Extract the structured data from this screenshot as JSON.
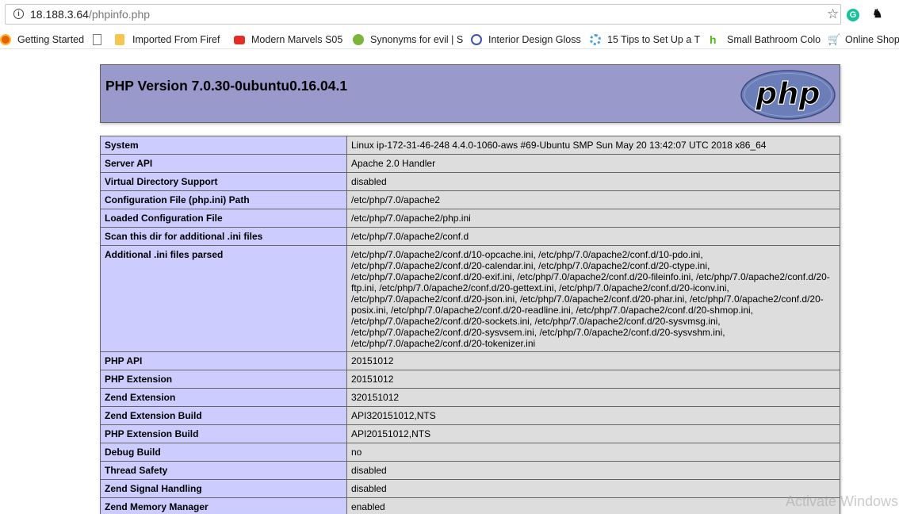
{
  "browser": {
    "url_host": "18.188.3.64",
    "url_path": "/phpinfo.php",
    "bookmarks": [
      {
        "label": "Getting Started",
        "icon": "firefox-icon"
      },
      {
        "label": "",
        "icon": "page-icon"
      },
      {
        "label": "Imported From Firef",
        "icon": "folder-icon"
      },
      {
        "label": "Modern Marvels S05",
        "icon": "youtube-icon"
      },
      {
        "label": "Synonyms for evil | S",
        "icon": "synonyms-icon"
      },
      {
        "label": "Interior Design Gloss",
        "icon": "q-icon"
      },
      {
        "label": "15 Tips to Set Up a T",
        "icon": "gear-icon"
      },
      {
        "label": "Small Bathroom Colo",
        "icon": "houzz-icon"
      },
      {
        "label": "Online Shop",
        "icon": "cart-icon"
      }
    ]
  },
  "phpinfo": {
    "title": "PHP Version 7.0.30-0ubuntu0.16.04.1",
    "logo_text": "php",
    "rows": [
      {
        "key": "System",
        "value": "Linux ip-172-31-46-248 4.4.0-1060-aws #69-Ubuntu SMP Sun May 20 13:42:07 UTC 2018 x86_64"
      },
      {
        "key": "Server API",
        "value": "Apache 2.0 Handler"
      },
      {
        "key": "Virtual Directory Support",
        "value": "disabled"
      },
      {
        "key": "Configuration File (php.ini) Path",
        "value": "/etc/php/7.0/apache2"
      },
      {
        "key": "Loaded Configuration File",
        "value": "/etc/php/7.0/apache2/php.ini"
      },
      {
        "key": "Scan this dir for additional .ini files",
        "value": "/etc/php/7.0/apache2/conf.d"
      },
      {
        "key": "Additional .ini files parsed",
        "value": "/etc/php/7.0/apache2/conf.d/10-opcache.ini, /etc/php/7.0/apache2/conf.d/10-pdo.ini, /etc/php/7.0/apache2/conf.d/20-calendar.ini, /etc/php/7.0/apache2/conf.d/20-ctype.ini, /etc/php/7.0/apache2/conf.d/20-exif.ini, /etc/php/7.0/apache2/conf.d/20-fileinfo.ini, /etc/php/7.0/apache2/conf.d/20-ftp.ini, /etc/php/7.0/apache2/conf.d/20-gettext.ini, /etc/php/7.0/apache2/conf.d/20-iconv.ini, /etc/php/7.0/apache2/conf.d/20-json.ini, /etc/php/7.0/apache2/conf.d/20-phar.ini, /etc/php/7.0/apache2/conf.d/20-posix.ini, /etc/php/7.0/apache2/conf.d/20-readline.ini, /etc/php/7.0/apache2/conf.d/20-shmop.ini, /etc/php/7.0/apache2/conf.d/20-sockets.ini, /etc/php/7.0/apache2/conf.d/20-sysvmsg.ini, /etc/php/7.0/apache2/conf.d/20-sysvsem.ini, /etc/php/7.0/apache2/conf.d/20-sysvshm.ini, /etc/php/7.0/apache2/conf.d/20-tokenizer.ini"
      },
      {
        "key": "PHP API",
        "value": "20151012"
      },
      {
        "key": "PHP Extension",
        "value": "20151012"
      },
      {
        "key": "Zend Extension",
        "value": "320151012"
      },
      {
        "key": "Zend Extension Build",
        "value": "API320151012,NTS"
      },
      {
        "key": "PHP Extension Build",
        "value": "API20151012,NTS"
      },
      {
        "key": "Debug Build",
        "value": "no"
      },
      {
        "key": "Thread Safety",
        "value": "disabled"
      },
      {
        "key": "Zend Signal Handling",
        "value": "disabled"
      },
      {
        "key": "Zend Memory Manager",
        "value": "enabled"
      }
    ]
  },
  "overlay": {
    "watermark": "Activate Windows"
  },
  "colors": {
    "header_bg": "#9999cc",
    "key_cell_bg": "#ccccff",
    "value_cell_bg": "#dddddd",
    "logo_bg": "#6c7eb7"
  }
}
